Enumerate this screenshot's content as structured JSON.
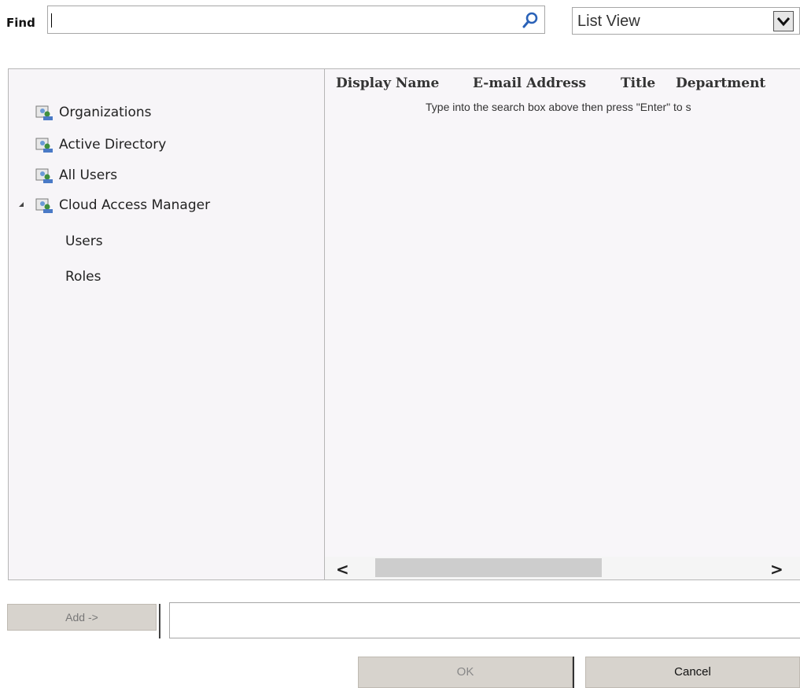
{
  "find": {
    "label": "Find",
    "value": "",
    "placeholder": "",
    "search_icon": "magnifier-icon"
  },
  "view_select": {
    "selected": "List View",
    "arrow_icon": "chevron-down-icon"
  },
  "tree": {
    "items": [
      {
        "label": "Organizations",
        "icon": "group-icon"
      },
      {
        "label": "Active Directory",
        "icon": "group-icon"
      },
      {
        "label": "All Users",
        "icon": "group-icon"
      },
      {
        "label": "Cloud Access Manager",
        "icon": "group-icon",
        "expanded": true,
        "children": [
          {
            "label": "Users"
          },
          {
            "label": "Roles"
          }
        ]
      }
    ]
  },
  "list": {
    "columns": [
      "Display Name",
      "E-mail Address",
      "Title",
      "Department"
    ],
    "hint": "Type into the search box above then press \"Enter\" to s",
    "scroll_left_label": "<",
    "scroll_right_label": ">"
  },
  "bottom": {
    "add_label": "Add ->",
    "ok_label": "OK",
    "cancel_label": "Cancel"
  },
  "colors": {
    "panel_bg": "#f7f5f8",
    "button_bg": "#d7d3cd",
    "border": "#b6b6b6",
    "search_icon": "#2a62b8"
  }
}
